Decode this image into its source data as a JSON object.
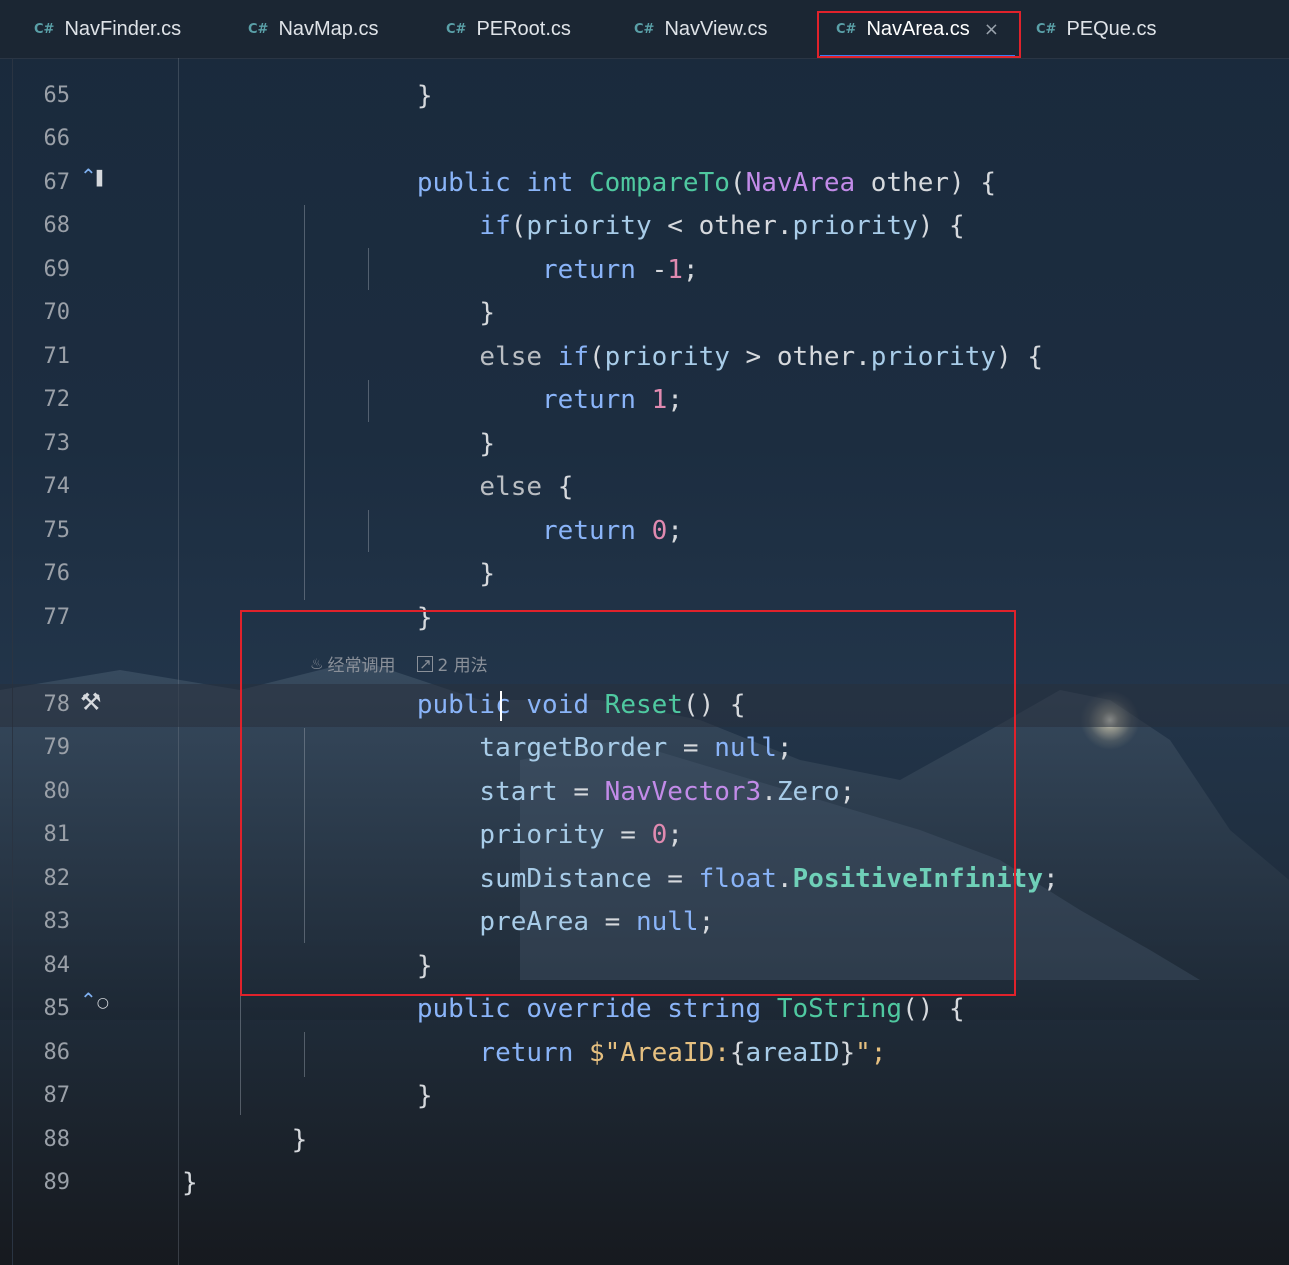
{
  "tabs": [
    {
      "icon": "C#",
      "label": "NavFinder.cs"
    },
    {
      "icon": "C#",
      "label": "NavMap.cs"
    },
    {
      "icon": "C#",
      "label": "PERoot.cs"
    },
    {
      "icon": "C#",
      "label": "NavView.cs"
    },
    {
      "icon": "C#",
      "label": "NavArea.cs",
      "close": "×"
    },
    {
      "icon": "C#",
      "label": "PEQue.cs"
    }
  ],
  "hint": {
    "frequent": "经常调用",
    "usages": "2 用法"
  },
  "lines": [
    {
      "n": "65"
    },
    {
      "n": "66"
    },
    {
      "n": "67"
    },
    {
      "n": "68"
    },
    {
      "n": "69"
    },
    {
      "n": "70"
    },
    {
      "n": "71"
    },
    {
      "n": "72"
    },
    {
      "n": "73"
    },
    {
      "n": "74"
    },
    {
      "n": "75"
    },
    {
      "n": "76"
    },
    {
      "n": "77"
    },
    {
      "n": "78"
    },
    {
      "n": "79"
    },
    {
      "n": "80"
    },
    {
      "n": "81"
    },
    {
      "n": "82"
    },
    {
      "n": "83"
    },
    {
      "n": "84"
    },
    {
      "n": "85"
    },
    {
      "n": "86"
    },
    {
      "n": "87"
    },
    {
      "n": "88"
    },
    {
      "n": "89"
    }
  ],
  "code": {
    "l65": "}",
    "l67_a": "public",
    "l67_b": "int",
    "l67_c": "CompareTo",
    "l67_d": "(",
    "l67_e": "NavArea",
    "l67_f": " other) {",
    "l68_a": "if",
    "l68_b": "(",
    "l68_c": "priority",
    "l68_d": " < other.",
    "l68_e": "priority",
    "l68_f": ") {",
    "l69_a": "return",
    "l69_b": " -",
    "l69_c": "1",
    "l69_d": ";",
    "l70": "}",
    "l71_a": "else",
    "l71_b": "if",
    "l71_c": "(",
    "l71_d": "priority",
    "l71_e": " > other.",
    "l71_f": "priority",
    "l71_g": ") {",
    "l72_a": "return",
    "l72_b": "1",
    "l72_c": ";",
    "l73": "}",
    "l74_a": "else",
    "l74_b": " {",
    "l75_a": "return",
    "l75_b": "0",
    "l75_c": ";",
    "l76": "}",
    "l77": "}",
    "l78_a": "public",
    "l78_b": "void",
    "l78_c": "Reset",
    "l78_d": "() {",
    "l79_a": "targetBorder",
    "l79_b": " = ",
    "l79_c": "null",
    "l79_d": ";",
    "l80_a": "start",
    "l80_b": " = ",
    "l80_c": "NavVector3",
    "l80_d": ".",
    "l80_e": "Zero",
    "l80_f": ";",
    "l81_a": "priority",
    "l81_b": " = ",
    "l81_c": "0",
    "l81_d": ";",
    "l82_a": "sumDistance",
    "l82_b": " = ",
    "l82_c": "float",
    "l82_d": ".",
    "l82_e": "PositiveInfinity",
    "l82_f": ";",
    "l83_a": "preArea",
    "l83_b": " = ",
    "l83_c": "null",
    "l83_d": ";",
    "l84": "}",
    "l85_a": "public",
    "l85_b": "override",
    "l85_c": "string",
    "l85_d": "ToString",
    "l85_e": "() {",
    "l86_a": "return",
    "l86_b": " $\"AreaID:",
    "l86_c": "{",
    "l86_d": "areaID",
    "l86_e": "}",
    "l86_f": "\";",
    "l87": "}",
    "l88": "}",
    "l89": "}"
  },
  "colors": {
    "highlight_box": "#e0222b",
    "active_tab_underline": "#3b7cf0"
  }
}
